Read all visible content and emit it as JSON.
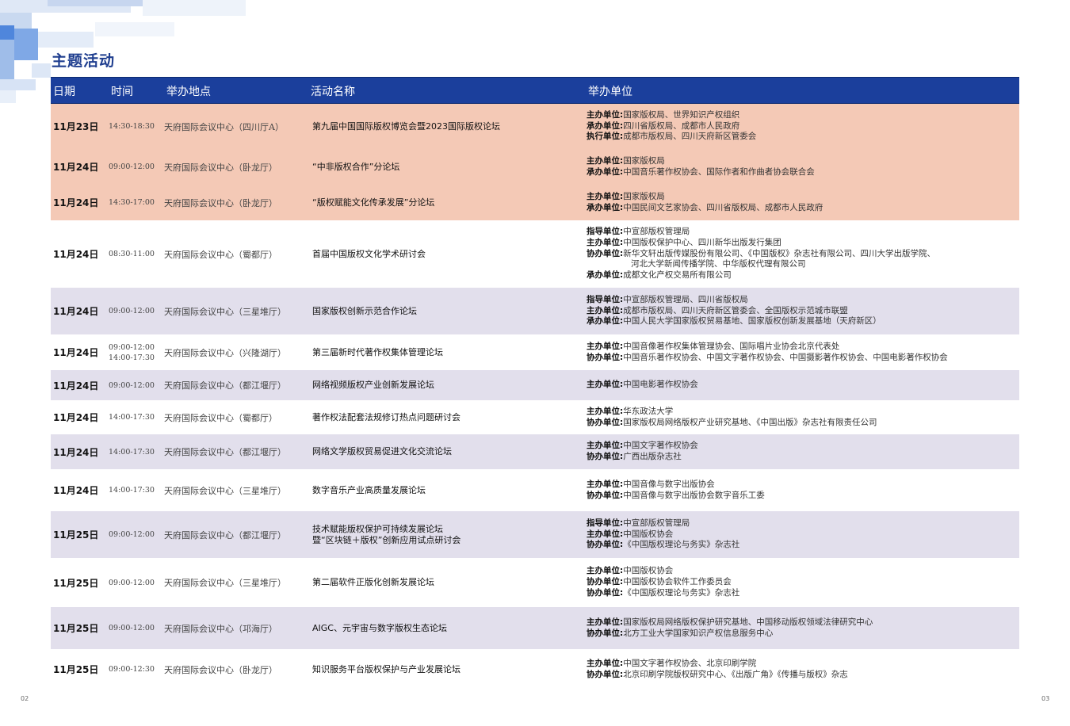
{
  "page_title": "主题活动",
  "headers": {
    "date": "日期",
    "time": "时间",
    "venue": "举办地点",
    "name": "活动名称",
    "org": "举办单位"
  },
  "page_numbers": {
    "left": "02",
    "right": "03"
  },
  "rows": [
    {
      "date": "11月23日",
      "time": [
        "14:30-18:30"
      ],
      "venue": "天府国际会议中心（四川厅A）",
      "name": [
        "第九届中国国际版权博览会暨2023国际版权论坛"
      ],
      "orgs": [
        {
          "role": "主办单位:",
          "value": "国家版权局、世界知识产权组织"
        },
        {
          "role": "承办单位:",
          "value": "四川省版权局、成都市人民政府"
        },
        {
          "role": "执行单位:",
          "value": "成都市版权局、四川天府新区管委会"
        }
      ]
    },
    {
      "date": "11月24日",
      "time": [
        "09:00-12:00"
      ],
      "venue": "天府国际会议中心（卧龙厅）",
      "name": [
        "“中非版权合作”分论坛"
      ],
      "orgs": [
        {
          "role": "主办单位:",
          "value": "国家版权局"
        },
        {
          "role": "承办单位:",
          "value": "中国音乐著作权协会、国际作者和作曲者协会联合会"
        }
      ]
    },
    {
      "date": "11月24日",
      "time": [
        "14:30-17:00"
      ],
      "venue": "天府国际会议中心（卧龙厅）",
      "name": [
        "“版权赋能文化传承发展”分论坛"
      ],
      "orgs": [
        {
          "role": "主办单位:",
          "value": "国家版权局"
        },
        {
          "role": "承办单位:",
          "value": "中国民间文艺家协会、四川省版权局、成都市人民政府"
        }
      ]
    },
    {
      "date": "11月24日",
      "time": [
        "08:30-11:00"
      ],
      "venue": "天府国际会议中心（蜀都厅）",
      "name": [
        "首届中国版权文化学术研讨会"
      ],
      "orgs": [
        {
          "role": "指导单位:",
          "value": "中宣部版权管理局"
        },
        {
          "role": "主办单位:",
          "value": "中国版权保护中心、四川新华出版发行集团"
        },
        {
          "role": "协办单位:",
          "value": "新华文轩出版传媒股份有限公司、《中国版权》杂志社有限公司、四川大学出版学院、"
        },
        {
          "role": "",
          "value": "河北大学新闻传播学院、中华版权代理有限公司"
        },
        {
          "role": "承办单位:",
          "value": "成都文化产权交易所有限公司"
        }
      ]
    },
    {
      "date": "11月24日",
      "time": [
        "09:00-12:00"
      ],
      "venue": "天府国际会议中心（三星堆厅）",
      "name": [
        "国家版权创新示范合作论坛"
      ],
      "orgs": [
        {
          "role": "指导单位:",
          "value": "中宣部版权管理局、四川省版权局"
        },
        {
          "role": "主办单位:",
          "value": "成都市版权局、四川天府新区管委会、全国版权示范城市联盟"
        },
        {
          "role": "承办单位:",
          "value": "中国人民大学国家版权贸易基地、国家版权创新发展基地（天府新区）"
        }
      ]
    },
    {
      "date": "11月24日",
      "time": [
        "09:00-12:00",
        "14:00-17:30"
      ],
      "venue": "天府国际会议中心（兴隆湖厅）",
      "name": [
        "第三届新时代著作权集体管理论坛"
      ],
      "orgs": [
        {
          "role": "主办单位:",
          "value": "中国音像著作权集体管理协会、国际唱片业协会北京代表处"
        },
        {
          "role": "协办单位:",
          "value": "中国音乐著作权协会、中国文字著作权协会、中国摄影著作权协会、中国电影著作权协会"
        }
      ]
    },
    {
      "date": "11月24日",
      "time": [
        "09:00-12:00"
      ],
      "venue": "天府国际会议中心（都江堰厅）",
      "name": [
        "网络视频版权产业创新发展论坛"
      ],
      "orgs": [
        {
          "role": "主办单位:",
          "value": "中国电影著作权协会"
        }
      ]
    },
    {
      "date": "11月24日",
      "time": [
        "14:00-17:30"
      ],
      "venue": "天府国际会议中心（蜀都厅）",
      "name": [
        "著作权法配套法规修订热点问题研讨会"
      ],
      "orgs": [
        {
          "role": "主办单位:",
          "value": "华东政法大学"
        },
        {
          "role": "协办单位:",
          "value": "国家版权局网络版权产业研究基地、《中国出版》杂志社有限责任公司"
        }
      ]
    },
    {
      "date": "11月24日",
      "time": [
        "14:00-17:30"
      ],
      "venue": "天府国际会议中心（都江堰厅）",
      "name": [
        "网络文学版权贸易促进文化交流论坛"
      ],
      "orgs": [
        {
          "role": "主办单位:",
          "value": "中国文字著作权协会"
        },
        {
          "role": "协办单位:",
          "value": "广西出版杂志社"
        }
      ]
    },
    {
      "date": "11月24日",
      "time": [
        "14:00-17:30"
      ],
      "venue": "天府国际会议中心（三星堆厅）",
      "name": [
        "数字音乐产业高质量发展论坛"
      ],
      "orgs": [
        {
          "role": "主办单位:",
          "value": "中国音像与数字出版协会"
        },
        {
          "role": "协办单位:",
          "value": "中国音像与数字出版协会数字音乐工委"
        }
      ]
    },
    {
      "date": "11月25日",
      "time": [
        "09:00-12:00"
      ],
      "venue": "天府国际会议中心（都江堰厅）",
      "name": [
        "技术赋能版权保护可持续发展论坛",
        "暨“区块链＋版权”创新应用试点研讨会"
      ],
      "orgs": [
        {
          "role": "指导单位:",
          "value": "中宣部版权管理局"
        },
        {
          "role": "主办单位:",
          "value": "中国版权协会"
        },
        {
          "role": "协办单位:",
          "value": "《中国版权理论与务实》杂志社"
        }
      ]
    },
    {
      "date": "11月25日",
      "time": [
        "09:00-12:00"
      ],
      "venue": "天府国际会议中心（三星堆厅）",
      "name": [
        "第二届软件正版化创新发展论坛"
      ],
      "orgs": [
        {
          "role": "主办单位:",
          "value": "中国版权协会"
        },
        {
          "role": "协办单位:",
          "value": "中国版权协会软件工作委员会"
        },
        {
          "role": "协办单位:",
          "value": "《中国版权理论与务实》杂志社"
        }
      ]
    },
    {
      "date": "11月25日",
      "time": [
        "09:00-12:00"
      ],
      "venue": "天府国际会议中心（邛海厅）",
      "name": [
        "AIGC、元宇宙与数字版权生态论坛"
      ],
      "orgs": [
        {
          "role": "主办单位:",
          "value": "国家版权局网络版权保护研究基地、中国移动版权领域法律研究中心"
        },
        {
          "role": "协办单位:",
          "value": "北方工业大学国家知识产权信息服务中心"
        }
      ]
    },
    {
      "date": "11月25日",
      "time": [
        "09:00-12:30"
      ],
      "venue": "天府国际会议中心（卧龙厅）",
      "name": [
        "知识服务平台版权保护与产业发展论坛"
      ],
      "orgs": [
        {
          "role": "主办单位:",
          "value": "中国文字著作权协会、北京印刷学院"
        },
        {
          "role": "协办单位:",
          "value": "北京印刷学院版权研究中心、《出版广角》《传播与版权》杂志"
        }
      ]
    }
  ]
}
